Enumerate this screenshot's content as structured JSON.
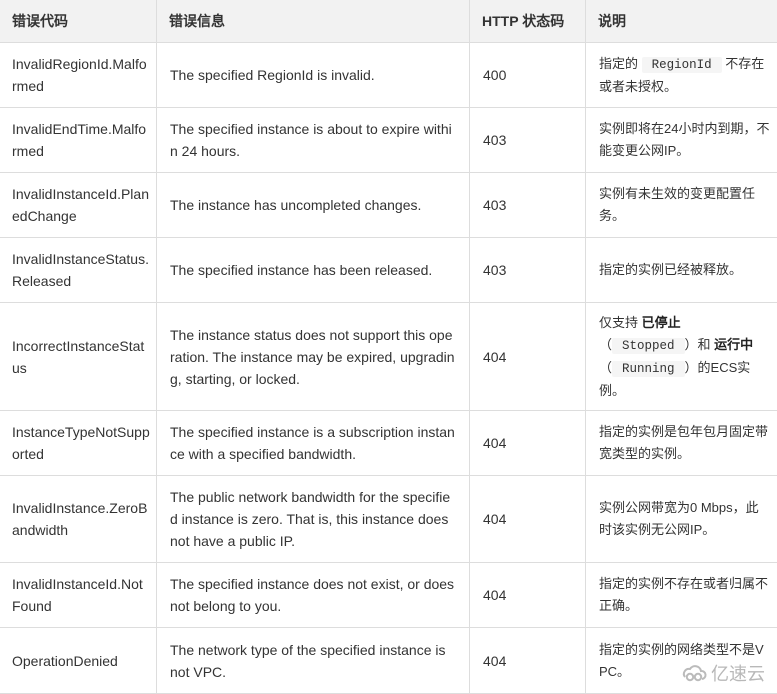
{
  "table": {
    "headers": {
      "code": "错误代码",
      "message": "错误信息",
      "status": "HTTP 状态码",
      "description": "说明"
    },
    "rows": [
      {
        "code": "InvalidRegionId.Malformed",
        "message": "The specified RegionId is invalid.",
        "status": "400",
        "desc": {
          "pre": "指定的",
          "code": "RegionId",
          "post": "不存在或者未授权。"
        }
      },
      {
        "code": "InvalidEndTime.Malformed",
        "message": "The specified instance is about to expire within 24 hours.",
        "status": "403",
        "desc": {
          "text": "实例即将在24小时内到期，不能变更公网IP。"
        }
      },
      {
        "code": "InvalidInstanceId.PlanedChange",
        "message": "The instance has uncompleted changes.",
        "status": "403",
        "desc": {
          "text": "实例有未生效的变更配置任务。"
        }
      },
      {
        "code": "InvalidInstanceStatus.Released",
        "message": "The specified instance has been released.",
        "status": "403",
        "desc": {
          "text": "指定的实例已经被释放。"
        }
      },
      {
        "code": "IncorrectInstanceStatus",
        "message": "The instance status does not support this operation. The instance may be expired, upgrading, starting, or locked.",
        "status": "404",
        "desc": {
          "pre": "仅支持",
          "bold1": "已停止",
          "open1": "（",
          "code1": "Stopped",
          "mid": "）和",
          "bold2": "运行中",
          "open2": "（",
          "code2": "Running",
          "post": "）的ECS实例。"
        }
      },
      {
        "code": "InstanceTypeNotSupported",
        "message": "The specified instance is a subscription instance with a specified bandwidth.",
        "status": "404",
        "desc": {
          "text": "指定的实例是包年包月固定带宽类型的实例。"
        }
      },
      {
        "code": "InvalidInstance.ZeroBandwidth",
        "message": "The public network bandwidth for the specified instance is zero. That is, this instance does not have a public IP.",
        "status": "404",
        "desc": {
          "text": "实例公网带宽为0 Mbps，此时该实例无公网IP。"
        }
      },
      {
        "code": "InvalidInstanceId.NotFound",
        "message": "The specified instance does not exist, or does not belong to you.",
        "status": "404",
        "desc": {
          "text": "指定的实例不存在或者归属不正确。"
        }
      },
      {
        "code": "OperationDenied",
        "message": "The network type of the specified instance is not VPC.",
        "status": "404",
        "desc": {
          "text": "指定的实例的网络类型不是VPC。"
        }
      }
    ]
  },
  "watermark": {
    "text": "亿速云",
    "icon": "cloud-logo-icon"
  }
}
